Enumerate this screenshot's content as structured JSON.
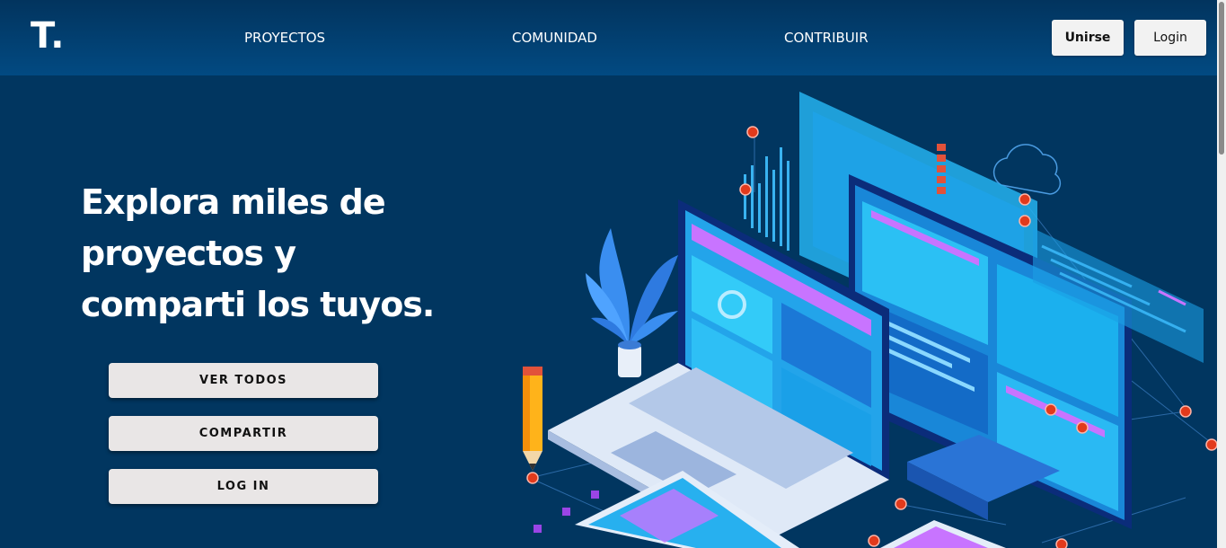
{
  "brand": {
    "logo": "T."
  },
  "nav": {
    "links": [
      "PROYECTOS",
      "COMUNIDAD",
      "CONTRIBUIR"
    ],
    "join_label": "Unirse",
    "login_label": "Login"
  },
  "hero": {
    "title_lines": [
      "Explora miles de",
      "proyectos y",
      "comparti los tuyos."
    ],
    "buttons": [
      "VER TODOS",
      "COMPARTIR",
      "LOG IN"
    ]
  },
  "colors": {
    "background": "#013660",
    "navbar": "#024a82",
    "button": "#e9e6e6"
  },
  "icons": [
    "cloud-icon",
    "plant-icon",
    "pencil-icon",
    "laptop-icon",
    "monitor-icon",
    "tablet-icon"
  ]
}
